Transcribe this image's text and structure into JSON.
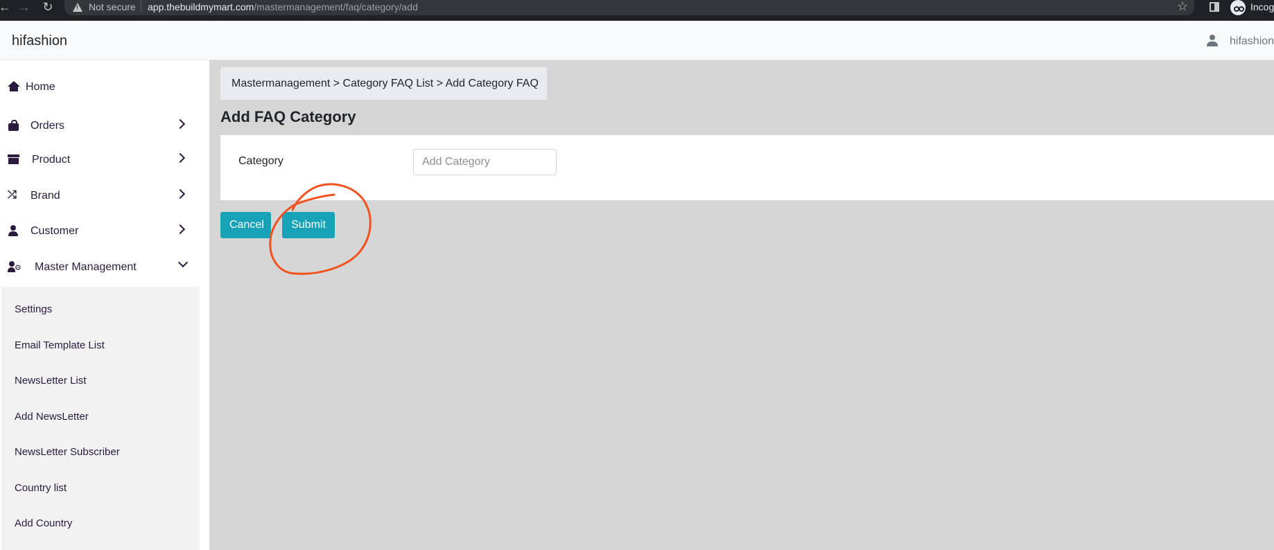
{
  "browser": {
    "security_label": "Not secure",
    "url_host": "app.thebuildmymart.com",
    "url_path": "/mastermanagement/faq/category/add",
    "profile_label": "Incognito"
  },
  "header": {
    "brand": "hifashion",
    "username": "hifashion"
  },
  "sidebar": {
    "items": [
      {
        "label": "Home",
        "icon": "home-icon"
      },
      {
        "label": "Orders",
        "icon": "shopping-bag-icon"
      },
      {
        "label": "Product",
        "icon": "archive-box-icon"
      },
      {
        "label": "Brand",
        "icon": "shuffle-icon"
      },
      {
        "label": "Customer",
        "icon": "user-icon"
      },
      {
        "label": "Master Management",
        "icon": "user-cog-icon"
      }
    ],
    "submenu": [
      "Settings",
      "Email Template List",
      "NewsLetter List",
      "Add NewsLetter",
      "NewsLetter Subscriber",
      "Country list",
      "Add Country"
    ]
  },
  "main": {
    "breadcrumb": "Mastermanagement > Category FAQ List > Add Category FAQ",
    "title": "Add FAQ Category",
    "form": {
      "category_label": "Category",
      "category_placeholder": "Add Category",
      "category_value": ""
    },
    "buttons": {
      "cancel": "Cancel",
      "submit": "Submit"
    }
  },
  "colors": {
    "button": "#17a2b8",
    "annotation": "#f4511e",
    "content_bg": "#d6d6d6",
    "nav_text": "#2a1a3e"
  }
}
